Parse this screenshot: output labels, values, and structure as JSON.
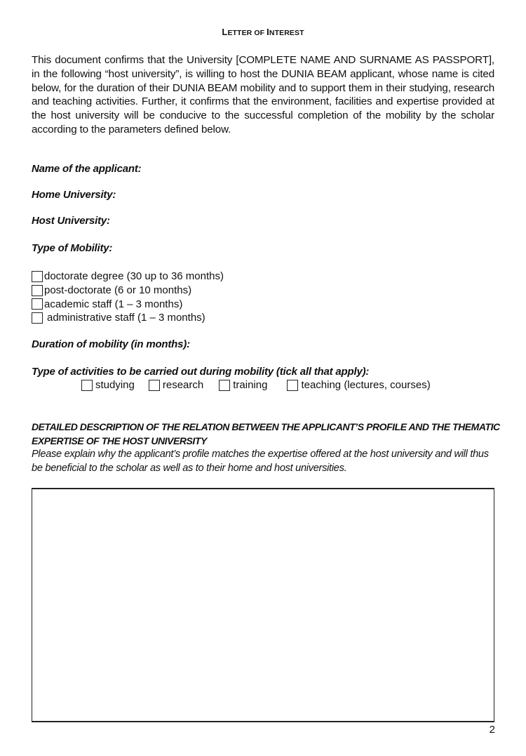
{
  "document": {
    "title_first_letter_1": "L",
    "title_rest_1": "ETTER OF ",
    "title_first_letter_2": "I",
    "title_rest_2": "NTEREST",
    "title": "Letter of Interest",
    "intro_paragraph": "This document confirms that the University [COMPLETE NAME AND SURNAME AS PASSPORT], in the following “host university”, is willing to host the DUNIA BEAM applicant, whose name is cited below, for the duration of their DUNIA BEAM mobility and to support them in their studying, research and teaching activities. Further, it confirms that the environment, facilities and expertise provided at the host university will be conducive to the successful completion of the mobility by the scholar according to the parameters defined below.",
    "page_number": "2"
  },
  "fields": {
    "applicant_name_label": "Name of the applicant:",
    "home_university_label": "Home University:",
    "host_university_label": "Host University:",
    "mobility_type_label": "Type of Mobility:",
    "duration_label": "Duration of mobility (in months):",
    "activities_label": "Type of activities to be carried out during mobility (tick all that apply):"
  },
  "mobility_options": [
    {
      "label": "doctorate degree (30 up to 36 months)",
      "checked": false
    },
    {
      "label": "post-doctorate (6 or 10 months)",
      "checked": false
    },
    {
      "label": "academic staff (1 – 3 months)",
      "checked": false
    },
    {
      "label": "administrative staff (1 – 3 months)",
      "checked": false
    }
  ],
  "activity_options": [
    {
      "label": "studying",
      "checked": false
    },
    {
      "label": "research",
      "checked": false
    },
    {
      "label": "training",
      "checked": false
    },
    {
      "label": "teaching (lectures, courses)",
      "checked": false
    }
  ],
  "description_section": {
    "heading": "DETAILED DESCRIPTION OF THE RELATION BETWEEN THE APPLICANT’S PROFILE AND THE THEMATIC EXPERTISE OF THE HOST UNIVERSITY",
    "instructions": "Please explain why the applicant’s profile matches the expertise offered at the host university and will thus be beneficial to the scholar as well as to their home and host universities.",
    "answer_value": ""
  }
}
